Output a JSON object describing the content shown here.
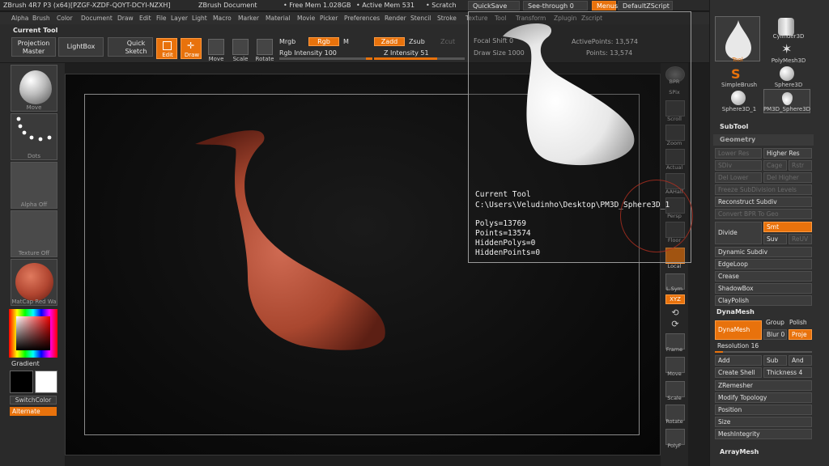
{
  "titlebar": {
    "app": "ZBrush 4R7 P3 (x64)[PZGF-XZDF-QOYT-DCYI-NZXH]",
    "doc": "ZBrush Document",
    "free_mem": "• Free Mem 1.028GB",
    "active_mem": "• Active Mem 531",
    "scratch": "• Scratch",
    "quicksave": "QuickSave",
    "seethrough": "See-through  0",
    "menus": "Menus",
    "script": "DefaultZScript"
  },
  "menubar": [
    "Alpha",
    "Brush",
    "Color",
    "Document",
    "Draw",
    "Edit",
    "File",
    "Layer",
    "Light",
    "Macro",
    "Marker",
    "Material",
    "Movie",
    "Picker",
    "Preferences",
    "Render",
    "Stencil",
    "Stroke",
    "Texture",
    "Tool",
    "Transform",
    "Zplugin",
    "Zscript"
  ],
  "shelf": {
    "current_tool": "Current Tool",
    "projection_master": "Projection Master",
    "lightbox": "LightBox",
    "quick_sketch": "Quick Sketch",
    "edit": "Edit",
    "draw": "Draw",
    "move": "Move",
    "scale": "Scale",
    "rotate": "Rotate",
    "mrgb": "Mrgb",
    "rgb": "Rgb",
    "m": "M",
    "rgb_intensity": "Rgb Intensity 100",
    "zadd": "Zadd",
    "zsub": "Zsub",
    "zcut": "Zcut",
    "z_intensity": "Z Intensity 51",
    "focal_shift": "Focal Shift 0",
    "draw_size": "Draw Size 1000",
    "active_points": "ActivePoints: 13,574",
    "total_points": "Points: 13,574"
  },
  "leftshelf": {
    "move": "Move",
    "dots": "Dots",
    "alpha": "Alpha  Off",
    "texture": "Texture  Off",
    "matcap": "MatCap Red Wa",
    "gradient": "Gradient",
    "switchcolor": "SwitchColor",
    "alternate": "Alternate"
  },
  "popup": {
    "title": "Current Tool",
    "path": "C:\\Users\\Veludinho\\Desktop\\PM3D_Sphere3D_1",
    "polys": "Polys=13769",
    "points": "Points=13574",
    "hidden_polys": "HiddenPolys=0",
    "hidden_points": "HiddenPoints=0"
  },
  "rightshelf": [
    "BPR",
    "SPix",
    "Scroll",
    "Zoom",
    "Actual",
    "AAHalf",
    "Persp",
    "Floor",
    "Local",
    "L.Sym",
    "XYZ",
    "",
    "",
    "Frame",
    "Move",
    "Scale",
    "Rotate",
    "PolyF"
  ],
  "rpanel": {
    "tool_label": "Tool",
    "cylinder": "Cylinder3D",
    "polymesh": "PolyMesh3D",
    "simplebrush": "SimpleBrush",
    "sphere3d": "Sphere3D",
    "sphere3d_1": "Sphere3D_1",
    "pm3d": "PM3D_Sphere3D",
    "subtool": "SubTool",
    "geometry": "Geometry",
    "lower_res": "Lower Res",
    "higher_res": "Higher Res",
    "sdiv": "SDiv",
    "cage": "Cage",
    "rstr": "Rstr",
    "del_lower": "Del Lower",
    "del_higher": "Del Higher",
    "freeze": "Freeze SubDivision Levels",
    "reconstruct": "Reconstruct Subdiv",
    "convert_bpr": "Convert BPR To Geo",
    "divide": "Divide",
    "smt": "Smt",
    "suv": "Suv",
    "reuv": "ReUV",
    "dynamic_subdiv": "Dynamic Subdiv",
    "edgeloop": "EdgeLoop",
    "crease": "Crease",
    "shadowbox": "ShadowBox",
    "claypolish": "ClayPolish",
    "dynamesh_hdr": "DynaMesh",
    "dynamesh_btn": "DynaMesh",
    "group": "Group",
    "polish": "Polish",
    "blur": "Blur 0",
    "project": "Proje",
    "resolution": "Resolution 16",
    "add": "Add",
    "sub": "Sub",
    "and": "And",
    "create_shell": "Create Shell",
    "thickness": "Thickness 4",
    "zremesher": "ZRemesher",
    "modify_topology": "Modify Topology",
    "position": "Position",
    "size": "Size",
    "meshintegrity": "MeshIntegrity",
    "arraymesh": "ArrayMesh"
  },
  "colors": {
    "accent": "#e8720c",
    "model_red": "#b4503c",
    "model_white": "#f2f2f2"
  }
}
